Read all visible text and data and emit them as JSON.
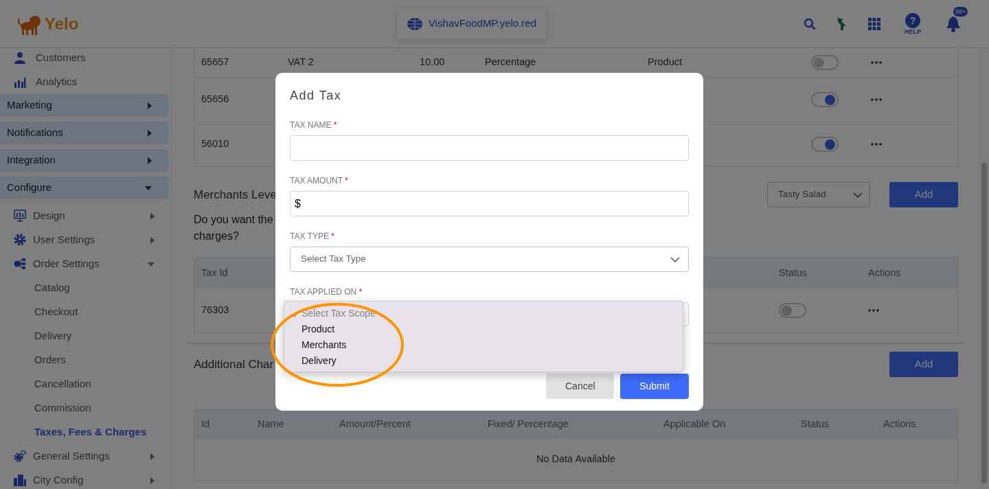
{
  "header": {
    "logo_text": "Yelo",
    "url": "VishavFoodMP.yelo.red",
    "help_glyph": "?",
    "help_label": "HELP",
    "notification_count": "99+"
  },
  "sidebar": {
    "items": [
      {
        "kind": "link",
        "label": "Customers"
      },
      {
        "kind": "link",
        "label": "Analytics"
      },
      {
        "kind": "section",
        "label": "Marketing",
        "expanded": false
      },
      {
        "kind": "section",
        "label": "Notifications",
        "expanded": false
      },
      {
        "kind": "section",
        "label": "Integration",
        "expanded": false
      },
      {
        "kind": "section",
        "label": "Configure",
        "expanded": true,
        "children": [
          {
            "kind": "group",
            "label": "Design",
            "expanded": false
          },
          {
            "kind": "group",
            "label": "User Settings",
            "expanded": false
          },
          {
            "kind": "group",
            "label": "Order Settings",
            "expanded": true,
            "children": [
              {
                "kind": "leaf",
                "label": "Catalog",
                "selected": false
              },
              {
                "kind": "leaf",
                "label": "Checkout",
                "selected": false
              },
              {
                "kind": "leaf",
                "label": "Delivery",
                "selected": false
              },
              {
                "kind": "leaf",
                "label": "Orders",
                "selected": false
              },
              {
                "kind": "leaf",
                "label": "Cancellation",
                "selected": false
              },
              {
                "kind": "leaf",
                "label": "Commission",
                "selected": false
              },
              {
                "kind": "leaf",
                "label": "Taxes, Fees & Charges",
                "selected": true
              }
            ]
          },
          {
            "kind": "group",
            "label": "General Settings",
            "expanded": false
          },
          {
            "kind": "group",
            "label": "City Config",
            "expanded": false
          }
        ]
      }
    ]
  },
  "taxes_table": {
    "rows": [
      {
        "tax_id": "65657",
        "name": "VAT 2",
        "amount": "10.00",
        "type": "Percentage",
        "applied_on": "Product",
        "on": false
      },
      {
        "tax_id": "65656",
        "on": true
      },
      {
        "tax_id": "56010",
        "on": true
      }
    ]
  },
  "merchants_level": {
    "title": "Merchants Leve",
    "question_lines": [
      "Do you want the",
      "charges?"
    ],
    "merchant_select": "Tasty Salad",
    "add_button": "Add",
    "table": {
      "columns": [
        "Tax Id",
        "Status",
        "Actions"
      ],
      "rows": [
        {
          "tax_id": "76303",
          "on": false
        }
      ]
    }
  },
  "additional_charges": {
    "title": "Additional Char",
    "add_button": "Add",
    "table": {
      "columns": [
        "Id",
        "Name",
        "Amount/Percent",
        "Fixed/ Percentage",
        "Applicable On",
        "Status",
        "Actions"
      ],
      "empty_text": "No Data Available"
    }
  },
  "modal": {
    "title": "Add Tax",
    "fields": [
      {
        "kind": "text",
        "label": "TAX NAME",
        "required_mark": "*"
      },
      {
        "kind": "amount",
        "label": "TAX AMOUNT",
        "required_mark": "*",
        "prefix": "$"
      },
      {
        "kind": "select",
        "label": "TAX TYPE",
        "required_mark": "*",
        "placeholder": "Select Tax Type"
      },
      {
        "kind": "open_select",
        "label": "TAX APPLIED ON",
        "required_mark": "*",
        "options": [
          {
            "label": "Select Tax Scope",
            "selected": true,
            "disabled": true
          },
          {
            "label": "Product",
            "selected": false,
            "disabled": false
          },
          {
            "label": "Merchants",
            "selected": false,
            "disabled": false
          },
          {
            "label": "Delivery",
            "selected": false,
            "disabled": false
          }
        ]
      }
    ],
    "buttons": [
      {
        "kind": "secondary",
        "label": "Cancel"
      },
      {
        "kind": "primary",
        "label": "Submit"
      }
    ]
  },
  "annotations": [
    {
      "kind": "ellipse"
    }
  ]
}
